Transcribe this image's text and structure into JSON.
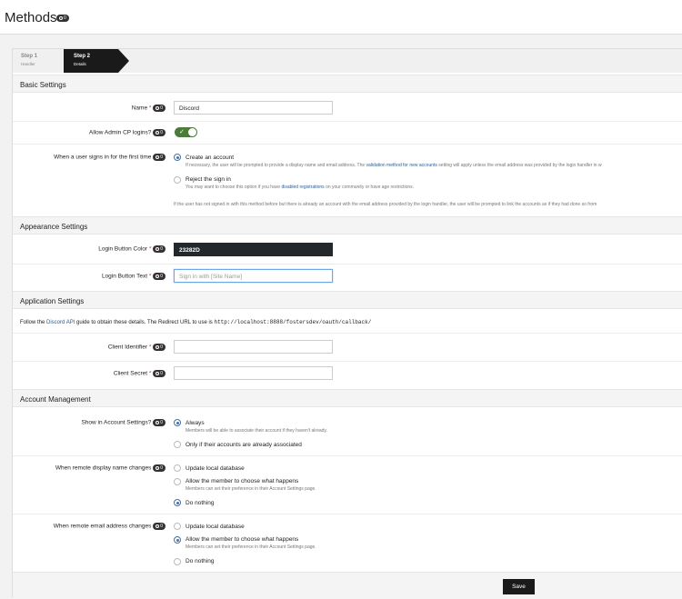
{
  "header": {
    "title": "Methods",
    "badge": "0"
  },
  "wizard": {
    "step1": {
      "title": "Step 1",
      "sub": "Handler"
    },
    "step2": {
      "title": "Step 2",
      "sub": "Details"
    }
  },
  "badge_text": "0",
  "sections": {
    "basic": "Basic Settings",
    "appearance": "Appearance Settings",
    "application": "Application Settings",
    "account": "Account Management"
  },
  "basic": {
    "name_label": "Name",
    "name_value": "Discord",
    "admin_label": "Allow Admin CP logins?",
    "first_time_label": "When a user signs in for the first time",
    "create_account": "Create an account",
    "create_desc_pre": "If necessary, the user will be prompted to provide a display name and email address. The ",
    "create_desc_link": "validation method for new accounts",
    "create_desc_post": " setting will apply unless the email address was provided by the login handler in w",
    "reject": "Reject the sign in",
    "reject_desc_pre": "You may want to choose this option if you have ",
    "reject_desc_link": "disabled registrations",
    "reject_desc_post": " on your community or have age restrictions.",
    "note": "If the user has not signed in with this method before but there is already an account with the email address provided by the login handler, the user will be prompted to link the accounts as if they had done so from"
  },
  "appearance": {
    "color_label": "Login Button Color",
    "color_value": "23282D",
    "text_label": "Login Button Text",
    "text_placeholder": "Sign in with [Site Name]"
  },
  "application": {
    "guide_pre": "Follow the ",
    "guide_link": "Discord API",
    "guide_mid": " guide to obtain these details. The Redirect URL to use is ",
    "guide_url": "http://localhost:8888/fostersdev/oauth/callback/",
    "client_id_label": "Client Identifier",
    "client_secret_label": "Client Secret"
  },
  "account": {
    "show_label": "Show in Account Settings?",
    "always": "Always",
    "always_desc": "Members will be able to associate their account if they haven't already.",
    "only_if": "Only if their accounts are already associated",
    "display_label": "When remote display name changes",
    "email_label": "When remote email address changes",
    "update_local": "Update local database",
    "allow_member": "Allow the member to choose what happens",
    "allow_desc": "Members can set their preference in their Account Settings page.",
    "do_nothing": "Do nothing"
  },
  "footer": {
    "save_label": "Save"
  },
  "colors": {
    "accent": "#4d7c3a",
    "link": "#2d5e94",
    "required": "#c0392b",
    "dark": "#23282d"
  }
}
